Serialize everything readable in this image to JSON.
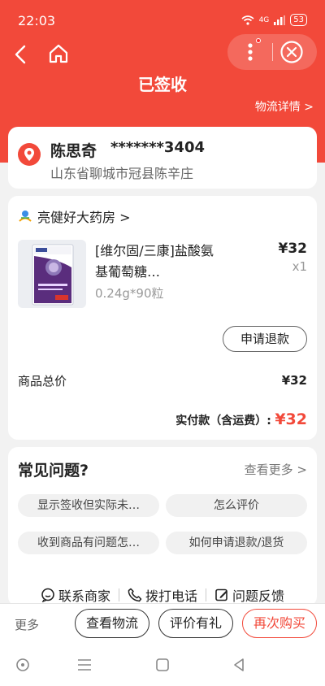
{
  "status_bar": {
    "time": "22:03",
    "network": "4G",
    "battery": "53"
  },
  "header": {
    "title": "已签收",
    "logistics_link": "物流详情 >"
  },
  "recipient": {
    "name": "陈思奇",
    "phone": "*******3404",
    "address": "山东省聊城市冠县陈辛庄"
  },
  "shop": {
    "name": "亮健好大药房 >"
  },
  "product": {
    "title": "[维尔固/三康]盐酸氨基葡萄糖…",
    "spec": "0.24g*90粒",
    "price": "¥32",
    "qty": "x1",
    "refund_label": "申请退款"
  },
  "summary": {
    "total_label": "商品总价",
    "total_value": "¥32",
    "paid_label": "实付款（含运费）:",
    "paid_value": "¥32"
  },
  "faq": {
    "title": "常见问题?",
    "more": "查看更多 >",
    "chips": [
      "显示签收但实际未…",
      "怎么评价",
      "收到商品有问题怎…",
      "如何申请退款/退货"
    ]
  },
  "contacts": {
    "merchant": "联系商家",
    "phone": "拨打电话",
    "feedback": "问题反馈"
  },
  "actions": {
    "more": "更多",
    "logistics": "查看物流",
    "review": "评价有礼",
    "rebuy": "再次购买"
  },
  "colors": {
    "brand_red": "#f2493a",
    "background": "#f2f2f2"
  }
}
